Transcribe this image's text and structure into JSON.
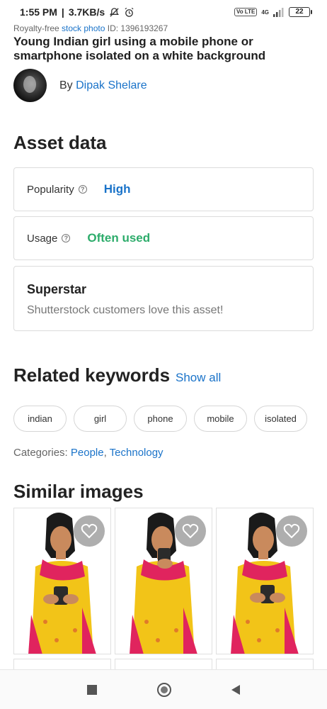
{
  "status_bar": {
    "time": "1:55 PM",
    "speed": "3.7KB/s",
    "network": "4G",
    "volte": "Vo LTE",
    "battery": "22"
  },
  "header": {
    "meta_prefix": "Royalty-free ",
    "meta_link": "stock photo",
    "meta_id": " ID: 1396193267",
    "title": "Young Indian girl using a mobile phone or smartphone isolated on a white background",
    "author_prefix": "By ",
    "author_name": "Dipak Shelare"
  },
  "asset_data": {
    "heading": "Asset data",
    "popularity_label": "Popularity",
    "popularity_value": "High",
    "usage_label": "Usage",
    "usage_value": "Often used",
    "superstar_title": "Superstar",
    "superstar_desc": "Shutterstock customers love this asset!",
    "colors": {
      "popularity": "#1a73c9",
      "usage": "#2dac6b"
    }
  },
  "keywords": {
    "heading": "Related keywords",
    "show_all": "Show all",
    "items": [
      "indian",
      "girl",
      "phone",
      "mobile",
      "isolated"
    ]
  },
  "categories": {
    "label": "Categories: ",
    "items": [
      "People",
      "Technology"
    ],
    "separator": ", "
  },
  "similar": {
    "heading": "Similar images",
    "icons": [
      "heart-icon",
      "heart-icon",
      "heart-icon"
    ]
  },
  "nav": {
    "icons": [
      "recents-square-icon",
      "home-circle-icon",
      "back-triangle-icon"
    ]
  }
}
